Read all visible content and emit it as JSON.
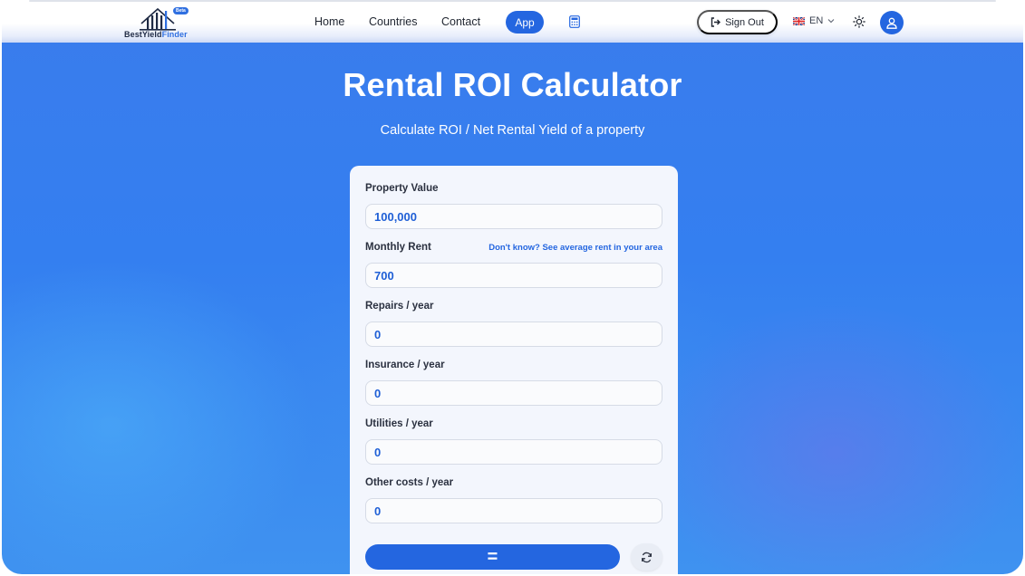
{
  "brand": {
    "name_part1": "BestYield",
    "name_part2": "Finder",
    "badge": "Beta"
  },
  "nav": {
    "home": "Home",
    "countries": "Countries",
    "contact": "Contact",
    "app": "App",
    "calculator_icon": "calculator-icon",
    "sign_out": "Sign Out",
    "language": "EN",
    "theme_icon": "sun-icon",
    "account_icon": "user-icon"
  },
  "hero": {
    "title": "Rental ROI Calculator",
    "subtitle": "Calculate ROI / Net Rental Yield of a property"
  },
  "form": {
    "property_value": {
      "label": "Property Value",
      "value": "100,000"
    },
    "monthly_rent": {
      "label": "Monthly Rent",
      "value": "700",
      "helper": "Don't know? See average rent in your area"
    },
    "repairs": {
      "label": "Repairs / year",
      "value": "0"
    },
    "insurance": {
      "label": "Insurance / year",
      "value": "0"
    },
    "utilities": {
      "label": "Utilities / year",
      "value": "0"
    },
    "other_costs": {
      "label": "Other costs / year",
      "value": "0"
    },
    "calculate_label": "=",
    "reset_icon": "refresh-icon"
  },
  "colors": {
    "primary": "#2466e0",
    "background": "#3a7cec",
    "card": "#f3f6fd",
    "input_text": "#1f5fd6"
  }
}
